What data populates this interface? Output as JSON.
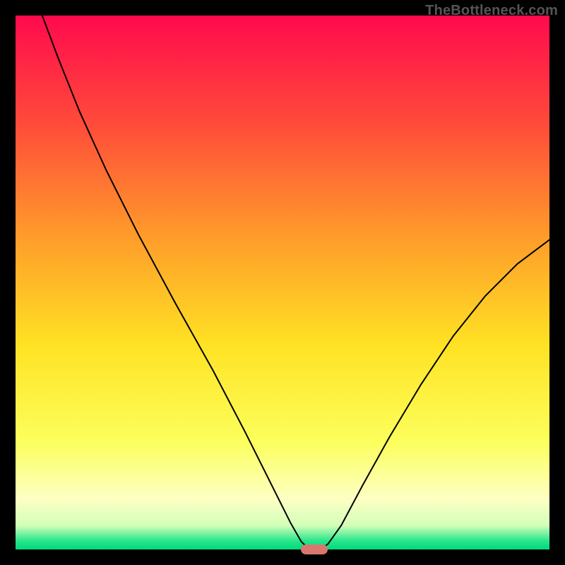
{
  "watermark": "TheBottleneck.com",
  "chart_data": {
    "type": "line",
    "title": "",
    "xlabel": "",
    "ylabel": "",
    "xlim": [
      0,
      100
    ],
    "ylim": [
      0,
      100
    ],
    "grid": false,
    "legend": false,
    "gradient_stops": [
      {
        "offset": 0,
        "color": "#ff0a4d"
      },
      {
        "offset": 0.2,
        "color": "#ff4a3a"
      },
      {
        "offset": 0.42,
        "color": "#ff9e2a"
      },
      {
        "offset": 0.62,
        "color": "#ffe324"
      },
      {
        "offset": 0.8,
        "color": "#fcff5d"
      },
      {
        "offset": 0.905,
        "color": "#fdffc3"
      },
      {
        "offset": 0.955,
        "color": "#d3ffb9"
      },
      {
        "offset": 0.985,
        "color": "#22e58a"
      },
      {
        "offset": 1.0,
        "color": "#00d97a"
      }
    ],
    "series": [
      {
        "name": "bottleneck-curve",
        "stroke": "#000000",
        "stroke_width": 2,
        "points": [
          {
            "x": 5.0,
            "y": 100.0
          },
          {
            "x": 8.0,
            "y": 92.0
          },
          {
            "x": 12.0,
            "y": 82.0
          },
          {
            "x": 17.0,
            "y": 71.0
          },
          {
            "x": 23.0,
            "y": 59.0
          },
          {
            "x": 30.0,
            "y": 46.0
          },
          {
            "x": 37.0,
            "y": 33.5
          },
          {
            "x": 43.0,
            "y": 22.0
          },
          {
            "x": 48.0,
            "y": 12.0
          },
          {
            "x": 51.5,
            "y": 5.0
          },
          {
            "x": 53.5,
            "y": 1.5
          },
          {
            "x": 55.0,
            "y": 0.0
          },
          {
            "x": 57.0,
            "y": 0.0
          },
          {
            "x": 58.5,
            "y": 1.0
          },
          {
            "x": 61.0,
            "y": 4.5
          },
          {
            "x": 65.0,
            "y": 12.0
          },
          {
            "x": 70.0,
            "y": 21.0
          },
          {
            "x": 76.0,
            "y": 31.0
          },
          {
            "x": 82.0,
            "y": 40.0
          },
          {
            "x": 88.0,
            "y": 47.5
          },
          {
            "x": 94.0,
            "y": 53.5
          },
          {
            "x": 100.0,
            "y": 58.0
          }
        ]
      }
    ],
    "marker": {
      "x_center_pct": 56.0,
      "y_pct": 0.0,
      "width_pct": 5.0,
      "height_pct": 1.8,
      "color": "#d9776e"
    }
  }
}
